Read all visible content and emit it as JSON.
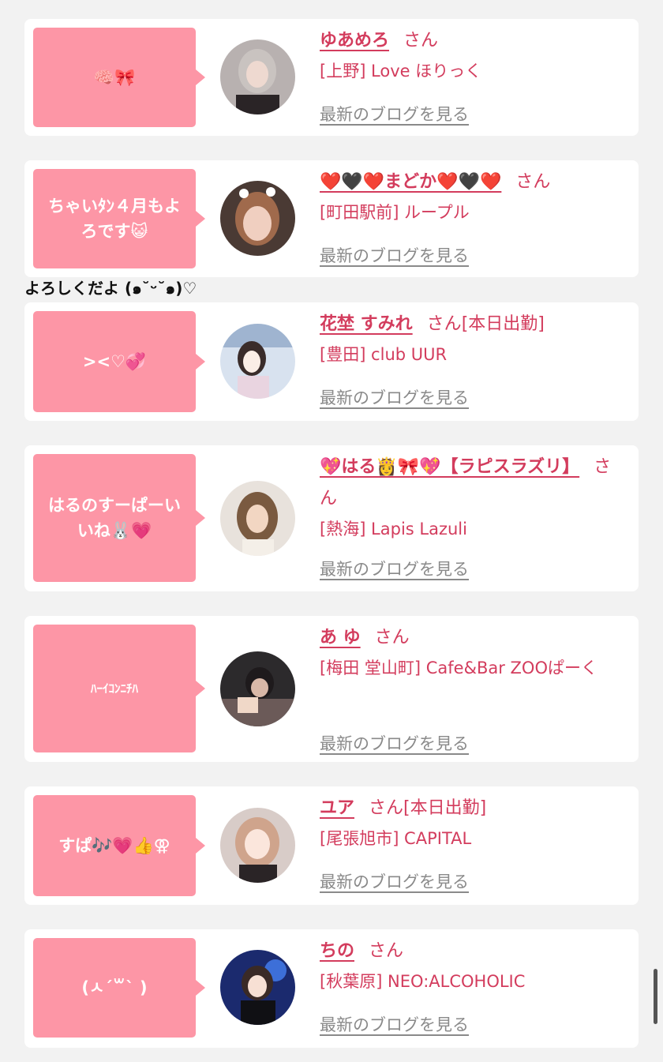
{
  "entries": [
    {
      "comment": "🧠🎀",
      "name": "ゆあめろ",
      "san": "さん",
      "shop": "[上野] Love ほりっく",
      "blog": "最新のブログを見る",
      "status": ""
    },
    {
      "comment": "ちゃいﾀﾝ４月もよろです😺",
      "name": "❤️🖤❤️まどか❤️🖤❤️",
      "san": "さん",
      "shop": "[町田駅前] ループル",
      "blog": "最新のブログを見る",
      "status": ""
    },
    {
      "comment": "><♡💞",
      "name": "花埜 すみれ",
      "san": "さん",
      "shop": "[豊田] club UUR",
      "blog": "最新のブログを見る",
      "status": "[本日出勤]"
    },
    {
      "comment": "はるのすーぱーいいね🐰💗",
      "name": "💖はる👸🎀💖【ラピスラズリ】",
      "san": "さん",
      "shop": "[熱海] Lapis Lazuli",
      "blog": "最新のブログを見る",
      "status": ""
    },
    {
      "comment": "ﾊｰｲｺﾝﾆﾁﾊ",
      "name": "あ ゆ",
      "san": "さん",
      "shop": "[梅田 堂山町] Cafe&Bar ZOOぱーく",
      "blog": "最新のブログを見る",
      "status": ""
    },
    {
      "comment": "すぱ🎶💗👍⚢",
      "name": "ユア",
      "san": "さん",
      "shop": "[尾張旭市] CAPITAL",
      "blog": "最新のブログを見る",
      "status": "[本日出勤]"
    },
    {
      "comment": "(ㅅ´꒳` )",
      "name": "ちの",
      "san": "さん",
      "shop": "[秋葉原] NEO:ALCOHOLIC",
      "blog": "最新のブログを見る",
      "status": ""
    }
  ],
  "banner_text": "よろしくだよ (๑˘ᵕ˘๑)♡",
  "colors": {
    "accent": "#d33c5d",
    "bubble": "#fd96a6",
    "background": "#f2f2f2"
  }
}
